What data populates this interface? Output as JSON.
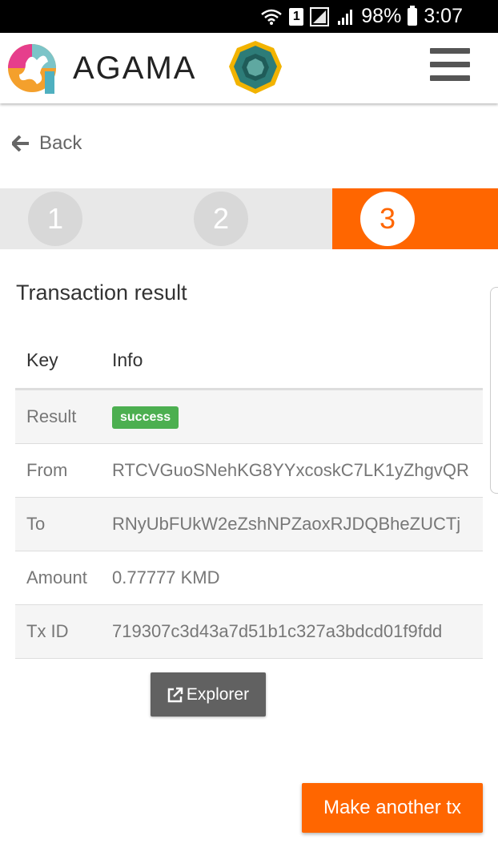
{
  "status_bar": {
    "sim": "1",
    "battery": "98%",
    "time": "3:07"
  },
  "header": {
    "brand": "AGAMA"
  },
  "nav": {
    "back_label": "Back"
  },
  "stepper": {
    "steps": [
      "1",
      "2",
      "3"
    ],
    "active_step": 3
  },
  "colors": {
    "accent": "#ff6600",
    "success": "#4caf50",
    "button_dark": "#616161"
  },
  "result": {
    "title": "Transaction result",
    "columns": [
      "Key",
      "Info"
    ],
    "rows": [
      {
        "key": "Result",
        "value": "success"
      },
      {
        "key": "From",
        "value": "RTCVGuoSNehKG8YYxcoskC7LK1yZhgvQR"
      },
      {
        "key": "To",
        "value": "RNyUbFUkW2eZshNPZaoxRJDQBheZUCTj"
      },
      {
        "key": "Amount",
        "value": "0.77777 KMD"
      },
      {
        "key": "Tx ID",
        "value": "719307c3d43a7d51b1c327a3bdcd01f9fdd"
      }
    ],
    "explorer_label": "Explorer",
    "make_another_label": "Make another tx"
  }
}
